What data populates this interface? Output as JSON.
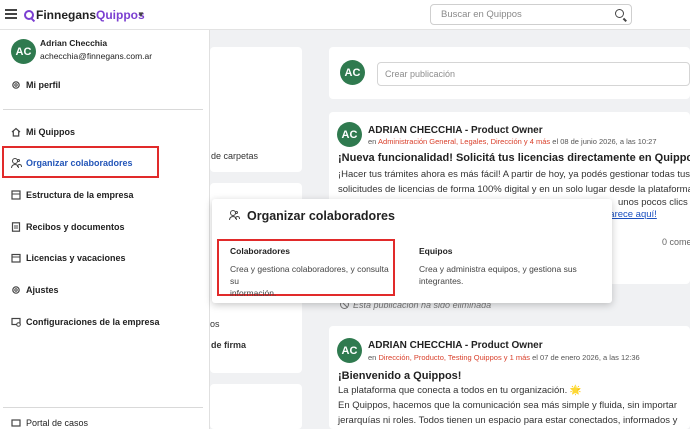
{
  "topbar": {
    "logo_part1": "Finnegans",
    "logo_part2": "Quippos",
    "search_placeholder": "Buscar en Quippos"
  },
  "user": {
    "initials": "AC",
    "name": "Adrian Checchia",
    "email": "achecchia@finnegans.com.ar"
  },
  "sidebar": {
    "profile": "Mi perfil",
    "items": [
      {
        "label": "Mi Quippos",
        "icon": "home-icon"
      },
      {
        "label": "Organizar colaboradores",
        "icon": "people-icon"
      },
      {
        "label": "Estructura de la empresa",
        "icon": "structure-icon"
      },
      {
        "label": "Recibos y documentos",
        "icon": "document-icon"
      },
      {
        "label": "Licencias y vacaciones",
        "icon": "calendar-icon"
      },
      {
        "label": "Ajustes",
        "icon": "gear-icon"
      },
      {
        "label": "Configuraciones de la empresa",
        "icon": "settings-icon"
      }
    ],
    "footer": "Portal de casos"
  },
  "popup": {
    "title": "Organizar colaboradores",
    "options": [
      {
        "title": "Colaboradores",
        "desc_line1": "Crea y gestiona colaboradores, y consulta su",
        "desc_line2": "información."
      },
      {
        "title": "Equipos",
        "desc_line1": "Crea y administra equipos, y gestiona sus",
        "desc_line2": "integrantes."
      }
    ]
  },
  "feed": {
    "create_placeholder": "Crear publicación",
    "post1": {
      "author": "ADRIAN CHECCHIA - Product Owner",
      "meta_prefix": "en ",
      "meta_tags": "Administración General, Legales, Dirección y 4 más",
      "meta_suffix": " el 08 de junio 2026, a las 10:27",
      "title": "¡Nueva funcionalidad! Solicitá tus licencias directamente en Quippos",
      "line1": "¡Hacer tus trámites ahora es más fácil! A partir de hoy, ya podés gestionar todas tus",
      "line2": "solicitudes de licencias de forma 100% digital y en un solo lugar desde la plataforma",
      "line3_end": "unos pocos clics",
      "link": "parece aquí!",
      "comments": "0 come"
    },
    "deleted_text": "Esta publicación ha sido eliminada",
    "post2": {
      "author": "ADRIAN CHECCHIA - Product Owner",
      "meta_prefix": "en ",
      "meta_tags": "Dirección, Producto, Testing Quippos y 1 más",
      "meta_suffix": " el 07 de enero 2026, a las 12:36",
      "title": "¡Bienvenido a Quippos!",
      "line1": "La plataforma que conecta a todos en tu organización. 🌟",
      "line2": "En Quippos, hacemos que la comunicación sea más simple y fluida, sin importar",
      "line3": "jerarquías ni roles. Todos tienen un espacio para estar conectados, informados y"
    },
    "left_fragments": {
      "carpetas": "de carpetas",
      "os": "os",
      "firma": "de firma"
    }
  },
  "colors": {
    "accent": "#7b3fd1",
    "avatar": "#2f7a4f",
    "highlight": "#e12a2a",
    "tag_red": "#d9402b"
  }
}
